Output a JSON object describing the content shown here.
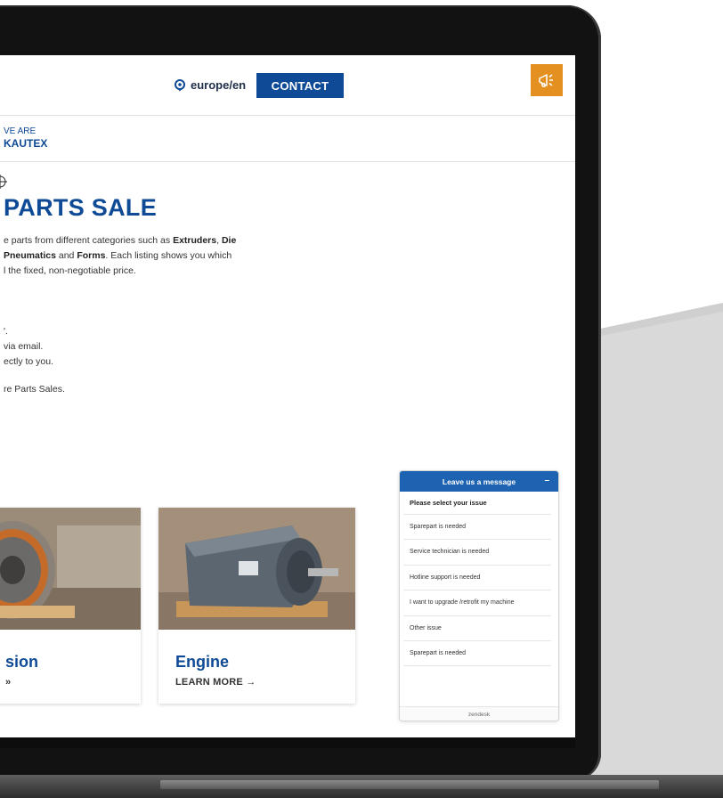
{
  "header": {
    "location_text": "europe/en",
    "contact_label": "CONTACT"
  },
  "breadcrumb": {
    "top": "VE ARE",
    "main": "KAUTEX"
  },
  "page": {
    "title": "PARTS SALE",
    "intro_lines": [
      "e parts from different categories such as Extruders, Die",
      "Pneumatics and Forms. Each listing shows you which",
      "l the fixed, non-negotiable price."
    ],
    "step_lines": [
      "'.",
      "via email.",
      "ectly to you."
    ],
    "closing": "re Parts Sales."
  },
  "cards": [
    {
      "title": "sion",
      "link": "»"
    },
    {
      "title": "Engine",
      "link": "LEARN MORE →"
    }
  ],
  "chat": {
    "header": "Leave us a message",
    "minimize": "–",
    "label": "Please select your issue",
    "options": [
      "Sparepart is needed",
      "Service technician is needed",
      "Hotline support is needed",
      "I want to upgrade /retrofit my machine",
      "Other issue",
      "Sparepart is needed"
    ],
    "footer": "zendesk"
  },
  "colors": {
    "brand_blue": "#0e4a96",
    "accent_orange": "#e39020",
    "chat_blue": "#1d63b2"
  }
}
